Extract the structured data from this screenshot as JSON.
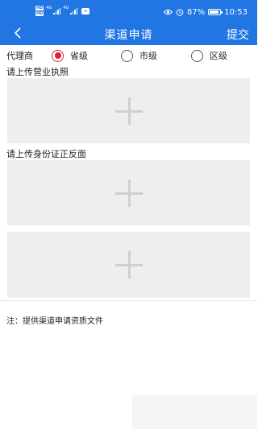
{
  "status_bar": {
    "time": "10:53",
    "battery_percent": "87%",
    "battery_level": 0.87,
    "hd_labels": [
      "HD",
      "HD"
    ],
    "network_labels": [
      "4G",
      "4G"
    ],
    "icons": [
      "eye-icon",
      "alarm-icon",
      "battery-icon",
      "signal-icon",
      "wifi-icon"
    ]
  },
  "header": {
    "title": "渠道申请",
    "submit_label": "提交",
    "back_icon": "chevron-left-icon",
    "background_color": "#2176e4"
  },
  "agent": {
    "label": "代理商",
    "options": [
      {
        "label": "省级",
        "checked": true
      },
      {
        "label": "市级",
        "checked": false
      },
      {
        "label": "区级",
        "checked": false
      }
    ],
    "accent_color": "#e0203a"
  },
  "uploads": {
    "license_label": "请上传营业执照",
    "id_label": "请上传身份证正反面",
    "add_icon": "plus-icon"
  },
  "note": "注：提供渠道申请资质文件"
}
